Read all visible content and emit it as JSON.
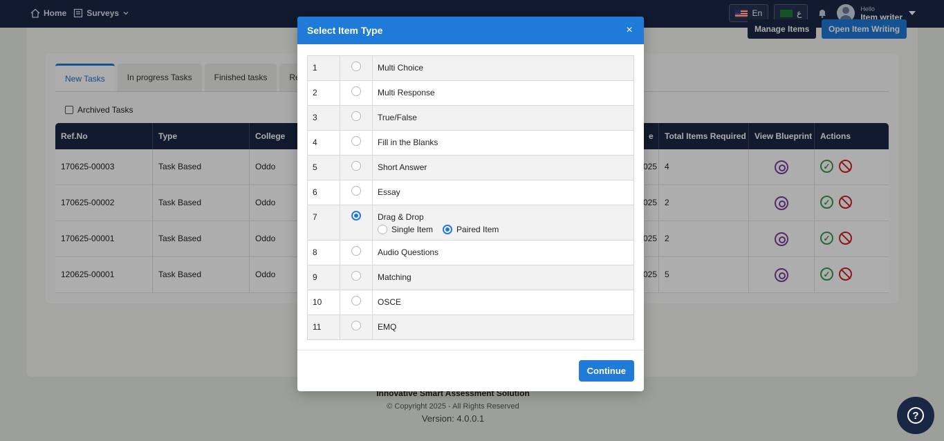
{
  "nav": {
    "home": "Home",
    "surveys": "Surveys",
    "lang_en": "En",
    "lang_ar": "ع",
    "hello": "Hello",
    "user_name": "Item writer"
  },
  "page": {
    "manage_items": "Manage Items",
    "open_item_writing": "Open Item Writing",
    "tabs": [
      "New Tasks",
      "In progress Tasks",
      "Finished tasks",
      "Re"
    ],
    "archived_label": "Archived Tasks",
    "columns": [
      "Ref.No",
      "Type",
      "College",
      "e",
      "Total Items Required",
      "View Blueprint",
      "Actions"
    ],
    "rows": [
      {
        "ref": "170625-00003",
        "type": "Task Based",
        "college": "Oddo",
        "date_frag": "025",
        "total": "4"
      },
      {
        "ref": "170625-00002",
        "type": "Task Based",
        "college": "Oddo",
        "date_frag": "025",
        "total": "2"
      },
      {
        "ref": "170625-00001",
        "type": "Task Based",
        "college": "Oddo",
        "date_frag": "025",
        "total": "2"
      },
      {
        "ref": "120625-00001",
        "type": "Task Based",
        "college": "Oddo",
        "date_frag": "025",
        "total": "5"
      }
    ]
  },
  "footer": {
    "brand": "Innovative Smart Assessment Solution",
    "copyright": "© Copyright 2025 - All Rights Reserved",
    "version": "Version: 4.0.0.1"
  },
  "modal": {
    "title": "Select Item Type",
    "close": "×",
    "continue": "Continue",
    "items": [
      {
        "num": "1",
        "label": "Multi Choice",
        "selected": false
      },
      {
        "num": "2",
        "label": "Multi Response",
        "selected": false
      },
      {
        "num": "3",
        "label": "True/False",
        "selected": false
      },
      {
        "num": "4",
        "label": "Fill in the Blanks",
        "selected": false
      },
      {
        "num": "5",
        "label": "Short Answer",
        "selected": false
      },
      {
        "num": "6",
        "label": "Essay",
        "selected": false
      },
      {
        "num": "7",
        "label": "Drag & Drop",
        "selected": true,
        "sub_options": [
          {
            "label": "Single Item",
            "selected": false
          },
          {
            "label": "Paired Item",
            "selected": true
          }
        ]
      },
      {
        "num": "8",
        "label": "Audio Questions",
        "selected": false
      },
      {
        "num": "9",
        "label": "Matching",
        "selected": false
      },
      {
        "num": "10",
        "label": "OSCE",
        "selected": false
      },
      {
        "num": "11",
        "label": "EMQ",
        "selected": false
      }
    ]
  },
  "colors": {
    "primary": "#1f7ad8",
    "navy": "#1a2744",
    "success": "#3d9a4a",
    "danger": "#cc2222",
    "blueprint": "#7a3fa0"
  }
}
